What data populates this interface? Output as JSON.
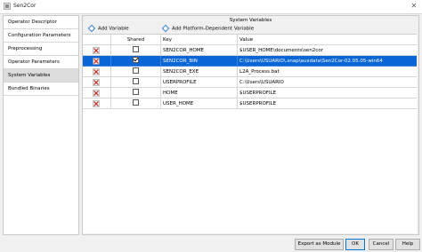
{
  "window": {
    "title": "Sen2Cor",
    "close_icon": "close-icon",
    "app_icon": "sen2cor-app-icon"
  },
  "sidebar": {
    "items": [
      {
        "label": "Operator Descriptor",
        "selected": false
      },
      {
        "label": "Configuration Parameters",
        "selected": false
      },
      {
        "label": "Preprocessing",
        "selected": false
      },
      {
        "label": "Operator Parameters",
        "selected": false
      },
      {
        "label": "System Variables",
        "selected": true
      },
      {
        "label": "Bundled Binaries",
        "selected": false
      }
    ]
  },
  "panel": {
    "title": "System Variables",
    "add_variable_label": "Add Variable",
    "add_platform_variable_label": "Add Platform-Dependent Variable",
    "columns": {
      "delete": "",
      "shared": "Shared",
      "key": "Key",
      "value": "Value"
    },
    "rows": [
      {
        "shared": false,
        "key": "SEN2COR_HOME",
        "value": "$USER_HOME\\documents\\sen2cor",
        "selected": false
      },
      {
        "shared": true,
        "key": "SEN2COR_BIN",
        "value": "C:\\Users\\USUARIO\\.snap\\auxdata\\Sen2Cor-02.05.05-win64",
        "selected": true
      },
      {
        "shared": false,
        "key": "SEN2COR_EXE",
        "value": "L2A_Process.bat",
        "selected": false
      },
      {
        "shared": false,
        "key": "USERPROFILE",
        "value": "C:\\Users\\USUARIO",
        "selected": false
      },
      {
        "shared": false,
        "key": "HOME",
        "value": "$USERPROFILE",
        "selected": false
      },
      {
        "shared": false,
        "key": "USER_HOME",
        "value": "$USERPROFILE",
        "selected": false
      }
    ]
  },
  "footer": {
    "export_label": "Export as Module",
    "ok_label": "OK",
    "cancel_label": "Cancel",
    "help_label": "Help"
  },
  "colors": {
    "selection": "#0a66d6",
    "delete_icon": "#c0392b",
    "link_diamond": "#3a7bd5"
  }
}
